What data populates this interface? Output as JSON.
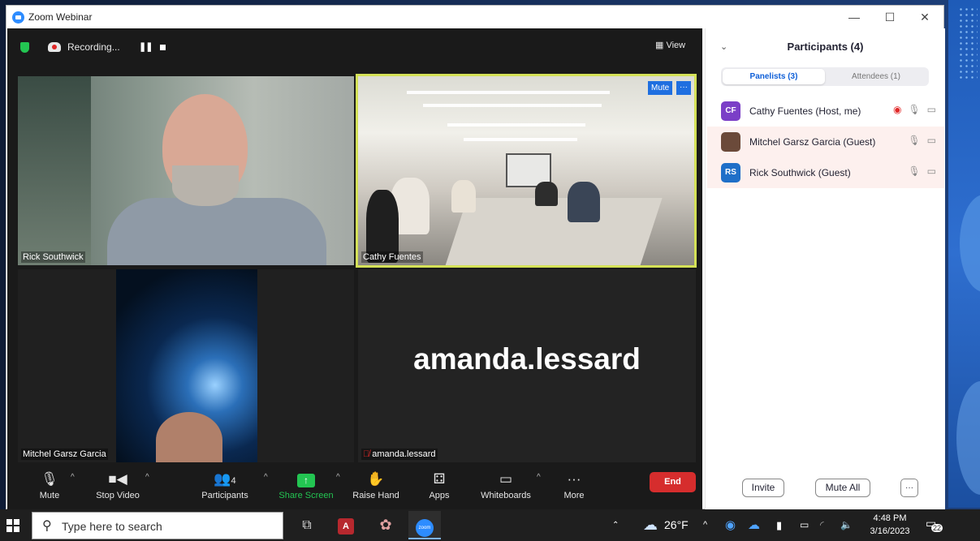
{
  "window": {
    "title": "Zoom Webinar",
    "min": "—",
    "max": "☐",
    "close": "✕"
  },
  "meeting_top": {
    "recording_label": "Recording...",
    "pause": "❚❚",
    "view_label": "View"
  },
  "tiles": {
    "t1_name": "Rick Southwick",
    "t2_name": "Cathy Fuentes",
    "t2_mute": "Mute",
    "t2_more": "···",
    "t3_name": "Mitchel Garsz Garcia",
    "t4_big": "amanda.lessard",
    "t4_name": "amanda.lessard"
  },
  "toolbar": {
    "mute": "Mute",
    "stop_video": "Stop Video",
    "participants": "Participants",
    "participants_count": "4",
    "share_screen": "Share Screen",
    "raise_hand": "Raise Hand",
    "apps": "Apps",
    "whiteboards": "Whiteboards",
    "more": "More",
    "end": "End"
  },
  "panel": {
    "title": "Participants (4)",
    "tab_panelists": "Panelists (3)",
    "tab_attendees": "Attendees (1)",
    "participants": [
      {
        "initials": "CF",
        "name": "Cathy Fuentes (Host, me)",
        "color": "#7b3fc7"
      },
      {
        "initials": "",
        "name": "Mitchel Garsz Garcia (Guest)",
        "color": "#6b4a3a"
      },
      {
        "initials": "RS",
        "name": "Rick Southwick (Guest)",
        "color": "#1f6fc8"
      }
    ],
    "invite": "Invite",
    "mute_all": "Mute All",
    "more": "···"
  },
  "taskbar": {
    "search_placeholder": "Type here to search",
    "temperature": "26°F",
    "time": "4:48 PM",
    "date": "3/16/2023",
    "notifications": "22"
  },
  "colors": {
    "accent_blue": "#2d8cff",
    "active_speaker": "#d4e157",
    "end_red": "#d62d2d",
    "share_green": "#23c552"
  }
}
